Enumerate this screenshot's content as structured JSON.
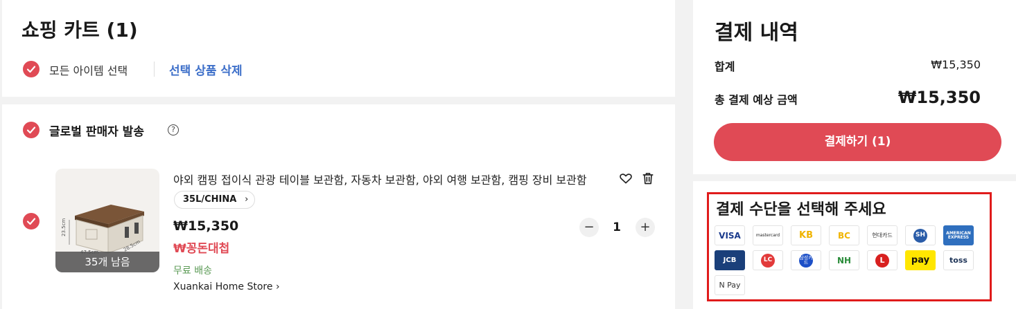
{
  "cart": {
    "title": "쇼핑 카트 (1)",
    "select_all_label": "모든 아이템 선택",
    "delete_selected_label": "선택 상품 삭제"
  },
  "seller": {
    "title": "글로벌 판매자 발송",
    "help_glyph": "?"
  },
  "item": {
    "title": "야외 캠핑 접이식 관광 테이블 보관함, 자동차 보관함, 야외 여행 보관함, 캠핑 장비 보관함",
    "option": "35L/CHINA",
    "option_chevron": "›",
    "price": "₩15,350",
    "deal": "₩꽁돈대첩",
    "shipping": "무료 배송",
    "store": "Xuankai Home Store ›",
    "stock_badge": "35개 남음",
    "quantity": "1",
    "minus": "−",
    "plus": "+",
    "dim_height": "23.5cm",
    "dim_width": "47.5cm",
    "dim_depth": "28.5cm"
  },
  "summary": {
    "title": "결제 내역",
    "subtotal_label": "합계",
    "subtotal_value": "₩15,350",
    "total_label": "총 결제 예상 금액",
    "total_value": "₩15,350",
    "checkout_button": "결제하기 (1)"
  },
  "payment": {
    "title": "결제 수단을 선택해 주세요",
    "methods": [
      {
        "name": "visa",
        "label": "VISA"
      },
      {
        "name": "mastercard",
        "label": "mastercard"
      },
      {
        "name": "kb-card",
        "label": "KB"
      },
      {
        "name": "bc-card",
        "label": "BC"
      },
      {
        "name": "hyundai-card",
        "label": "현대카드"
      },
      {
        "name": "shinhan-card",
        "label": "SH"
      },
      {
        "name": "amex",
        "label": "AMERICAN EXPRESS"
      },
      {
        "name": "jcb",
        "label": "JCB"
      },
      {
        "name": "lotte-card",
        "label": "LC"
      },
      {
        "name": "samsung-card",
        "label": "삼성카드"
      },
      {
        "name": "nh-card",
        "label": "NH"
      },
      {
        "name": "lotte-pay",
        "label": "L"
      },
      {
        "name": "kakao-pay",
        "label": "pay"
      },
      {
        "name": "toss",
        "label": "toss"
      },
      {
        "name": "naver-pay",
        "label": "N Pay"
      }
    ]
  },
  "colors": {
    "accent": "#e04a55",
    "link": "#3d6fc9",
    "shipping": "#5a9a54",
    "highlight_border": "#e01b1b"
  }
}
